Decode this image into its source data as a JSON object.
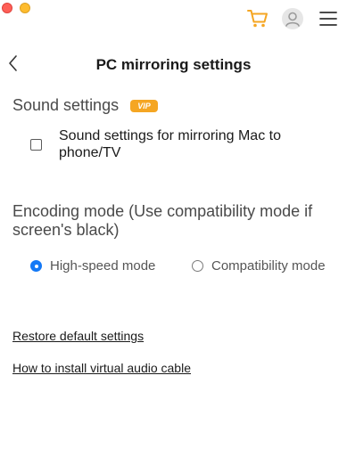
{
  "window": {
    "controls": [
      "close",
      "minimize"
    ]
  },
  "toolbar": {
    "cart_icon": "cart-icon",
    "account_icon": "user-avatar-icon",
    "menu_icon": "hamburger-menu-icon",
    "accent_color": "#f5a623"
  },
  "header": {
    "back_icon": "chevron-left-icon",
    "title": "PC mirroring settings"
  },
  "sound_settings": {
    "title": "Sound settings",
    "badge": "VIP",
    "option": {
      "label": "Sound settings for mirroring Mac to phone/TV",
      "checked": false
    }
  },
  "encoding": {
    "title": "Encoding mode (Use compatibility mode if screen's black)",
    "options": [
      {
        "label": "High-speed mode",
        "selected": true
      },
      {
        "label": "Compatibility mode",
        "selected": false
      }
    ],
    "selected_color": "#1479f6"
  },
  "links": {
    "restore": "Restore default settings",
    "install_audio": "How to install virtual audio cable"
  }
}
